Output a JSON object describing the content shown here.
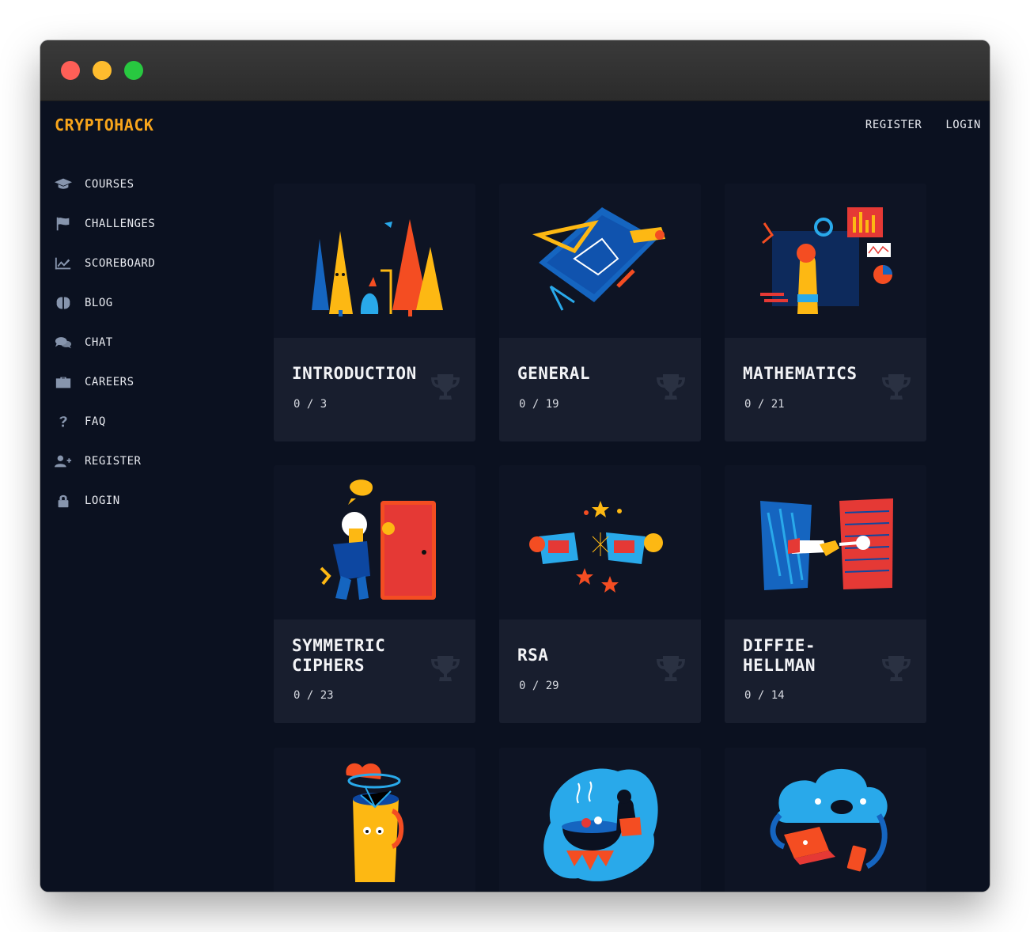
{
  "brand": "CRYPTOHACK",
  "topnav": {
    "register": "REGISTER",
    "login": "LOGIN"
  },
  "sidebar": {
    "items": [
      {
        "label": "COURSES",
        "icon": "graduation-cap-icon"
      },
      {
        "label": "CHALLENGES",
        "icon": "flag-icon"
      },
      {
        "label": "SCOREBOARD",
        "icon": "chart-line-icon"
      },
      {
        "label": "BLOG",
        "icon": "brain-icon"
      },
      {
        "label": "CHAT",
        "icon": "chat-bubbles-icon"
      },
      {
        "label": "CAREERS",
        "icon": "briefcase-icon"
      },
      {
        "label": "FAQ",
        "icon": "question-icon"
      },
      {
        "label": "REGISTER",
        "icon": "user-plus-icon"
      },
      {
        "label": "LOGIN",
        "icon": "lock-icon"
      }
    ]
  },
  "categories": [
    {
      "title": "INTRODUCTION",
      "progress": "0 / 3",
      "illustration": "trees-illustration"
    },
    {
      "title": "GENERAL",
      "progress": "0 / 19",
      "illustration": "blueprint-illustration"
    },
    {
      "title": "MATHEMATICS",
      "progress": "0 / 21",
      "illustration": "charts-illustration"
    },
    {
      "title": "SYMMETRIC CIPHERS",
      "progress": "0 / 23",
      "illustration": "door-illustration"
    },
    {
      "title": "RSA",
      "progress": "0 / 29",
      "illustration": "fireworks-illustration"
    },
    {
      "title": "DIFFIE-HELLMAN",
      "progress": "0 / 14",
      "illustration": "handshake-illustration"
    },
    {
      "illustration": "mug-illustration"
    },
    {
      "illustration": "cauldron-illustration"
    },
    {
      "illustration": "cloud-illustration"
    }
  ],
  "colors": {
    "accent": "#f8a51b",
    "background": "#0b1120",
    "card": "#181e2e",
    "icon": "#8795ad"
  }
}
